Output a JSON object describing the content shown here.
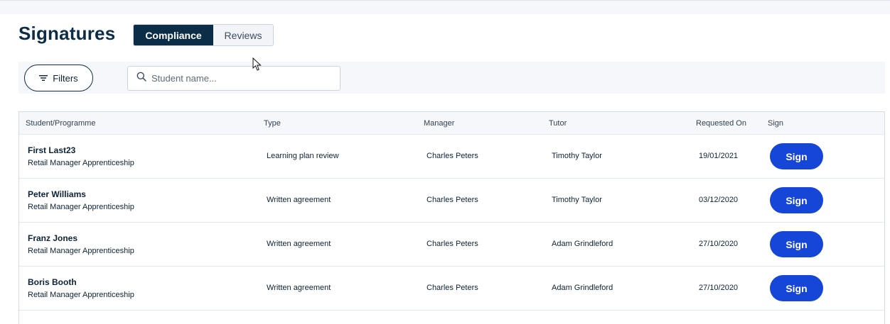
{
  "page": {
    "title": "Signatures"
  },
  "tabs": [
    {
      "label": "Compliance",
      "active": true
    },
    {
      "label": "Reviews",
      "active": false
    }
  ],
  "filters": {
    "button_label": "Filters",
    "search_placeholder": "Student name...",
    "search_value": ""
  },
  "table": {
    "columns": {
      "student": "Student/Programme",
      "type": "Type",
      "manager": "Manager",
      "tutor": "Tutor",
      "requested_on": "Requested On",
      "sign": "Sign"
    },
    "rows": [
      {
        "student": "First Last23",
        "programme": "Retail Manager Apprenticeship",
        "type": "Learning plan review",
        "manager": "Charles Peters",
        "tutor": "Timothy Taylor",
        "requested_on": "19/01/2021",
        "sign_label": "Sign"
      },
      {
        "student": "Peter Williams",
        "programme": "Retail Manager Apprenticeship",
        "type": "Written agreement",
        "manager": "Charles Peters",
        "tutor": "Timothy Taylor",
        "requested_on": "03/12/2020",
        "sign_label": "Sign"
      },
      {
        "student": "Franz Jones",
        "programme": "Retail Manager Apprenticeship",
        "type": "Written agreement",
        "manager": "Charles Peters",
        "tutor": "Adam Grindleford",
        "requested_on": "27/10/2020",
        "sign_label": "Sign"
      },
      {
        "student": "Boris Booth",
        "programme": "Retail Manager Apprenticeship",
        "type": "Written agreement",
        "manager": "Charles Peters",
        "tutor": "Adam Grindleford",
        "requested_on": "27/10/2020",
        "sign_label": "Sign"
      }
    ]
  },
  "colors": {
    "navy": "#0c2d48",
    "sign_button": "#1546d8",
    "panel_bg": "#f5f7fb"
  },
  "icons": {
    "filter": "filter-lines-icon",
    "search": "magnifier-icon",
    "cursor": "mouse-pointer-icon"
  }
}
